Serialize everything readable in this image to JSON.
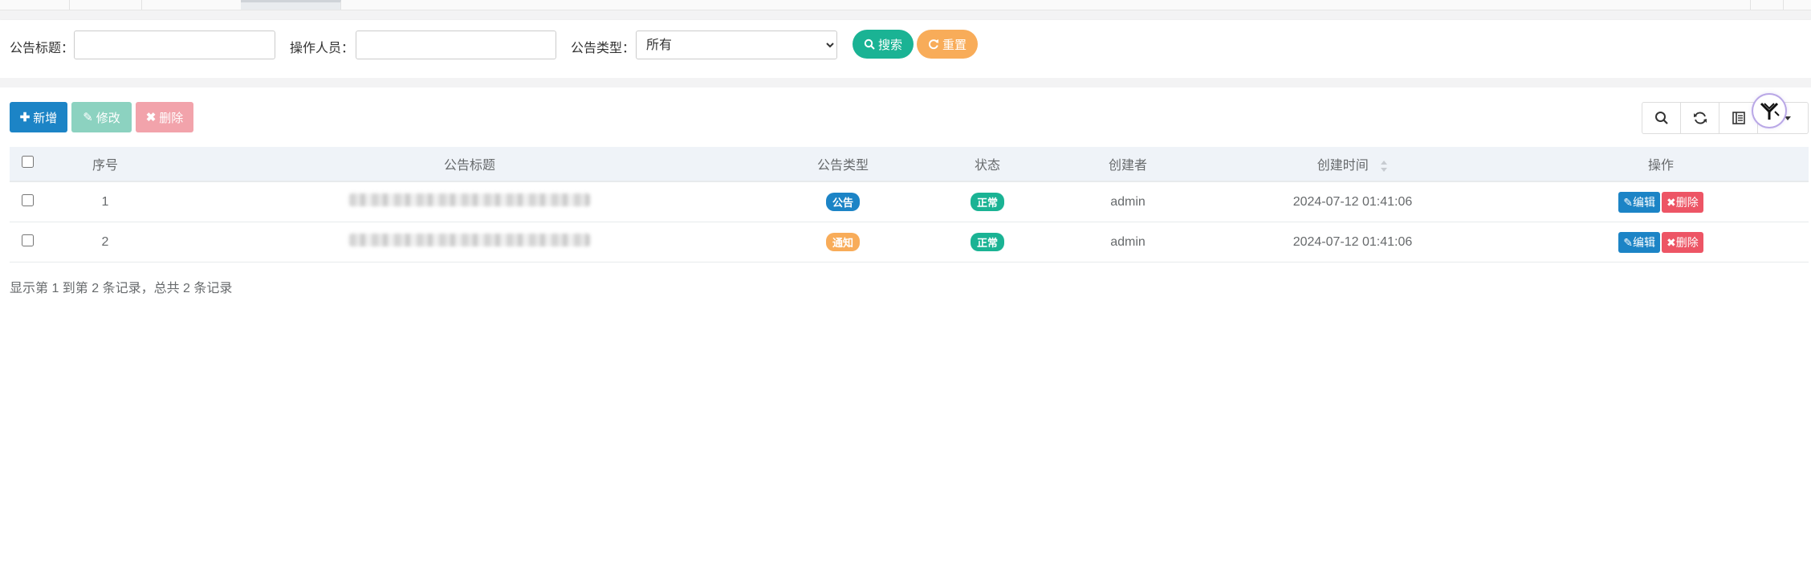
{
  "filters": {
    "title_label": "公告标题：",
    "title_value": "",
    "operator_label": "操作人员：",
    "operator_value": "",
    "type_label": "公告类型：",
    "type_selected": "所有",
    "search_label": "搜索",
    "reset_label": "重置"
  },
  "toolbar": {
    "add_label": "新增",
    "edit_label": "修改",
    "delete_label": "删除"
  },
  "table": {
    "columns": [
      "序号",
      "公告标题",
      "公告类型",
      "状态",
      "创建者",
      "创建时间",
      "操作"
    ],
    "rows": [
      {
        "index": "1",
        "type": "公告",
        "status": "正常",
        "creator": "admin",
        "created": "2024-07-12 01:41:06"
      },
      {
        "index": "2",
        "type": "通知",
        "status": "正常",
        "creator": "admin",
        "created": "2024-07-12 01:41:06"
      }
    ],
    "edit_label": "编辑",
    "delete_label": "删除"
  },
  "pager": {
    "summary": "显示第 1 到第 2 条记录，总共 2 条记录"
  },
  "icons": {
    "search": "search-icon",
    "refresh": "refresh-icon",
    "columns": "columns-icon",
    "export": "export-icon"
  },
  "colors": {
    "primary": "#1c84c6",
    "success": "#1ab394",
    "warning": "#f8ac59",
    "danger": "#ed5565"
  }
}
